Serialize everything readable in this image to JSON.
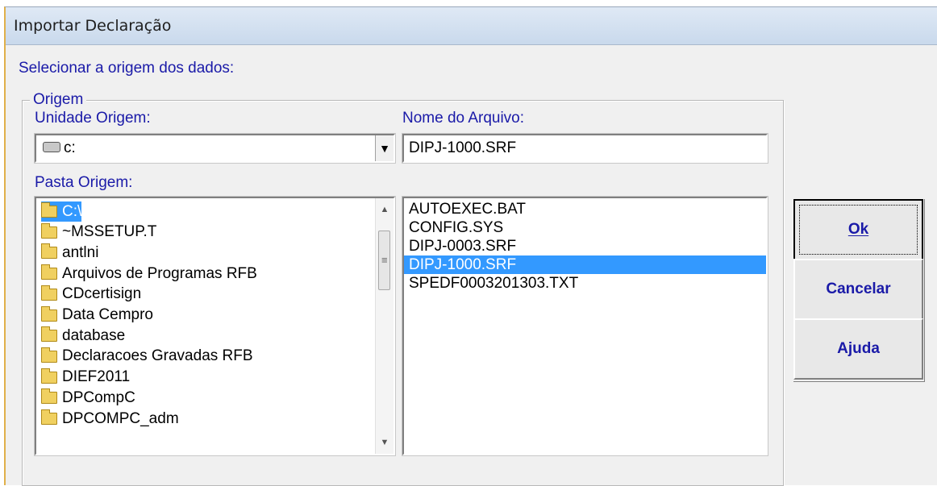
{
  "window": {
    "title": "Importar Declaração"
  },
  "dialog": {
    "prompt": "Selecionar a origem dos dados:",
    "group_label": "Origem",
    "drive_label": "Unidade Origem:",
    "drive_value": "c:",
    "filename_label": "Nome do Arquivo:",
    "filename_value": "DIPJ-1000.SRF",
    "folder_label": "Pasta Origem:",
    "folders": [
      {
        "label": "C:\\",
        "selected": true
      },
      {
        "label": "~MSSETUP.T"
      },
      {
        "label": "antlni"
      },
      {
        "label": "Arquivos de Programas RFB"
      },
      {
        "label": "CDcertisign"
      },
      {
        "label": "Data Cempro"
      },
      {
        "label": "database"
      },
      {
        "label": "Declaracoes Gravadas RFB"
      },
      {
        "label": "DIEF2011"
      },
      {
        "label": "DPCompC"
      },
      {
        "label": "DPCOMPC_adm"
      }
    ],
    "files": [
      {
        "label": "AUTOEXEC.BAT"
      },
      {
        "label": "CONFIG.SYS"
      },
      {
        "label": "DIPJ-0003.SRF"
      },
      {
        "label": "DIPJ-1000.SRF",
        "selected": true
      },
      {
        "label": "SPEDF0003201303.TXT"
      }
    ]
  },
  "buttons": {
    "ok": "Ok",
    "cancel": "Cancelar",
    "help": "Ajuda"
  },
  "icons": {
    "drive": "drive-icon",
    "folder": "folder-icon",
    "open_folder": "open-folder-icon",
    "dropdown": "chevron-down-icon"
  },
  "colors": {
    "label_text": "#1a1aa8",
    "selection": "#3399ff",
    "dialog_bg": "#f0f0f0"
  }
}
